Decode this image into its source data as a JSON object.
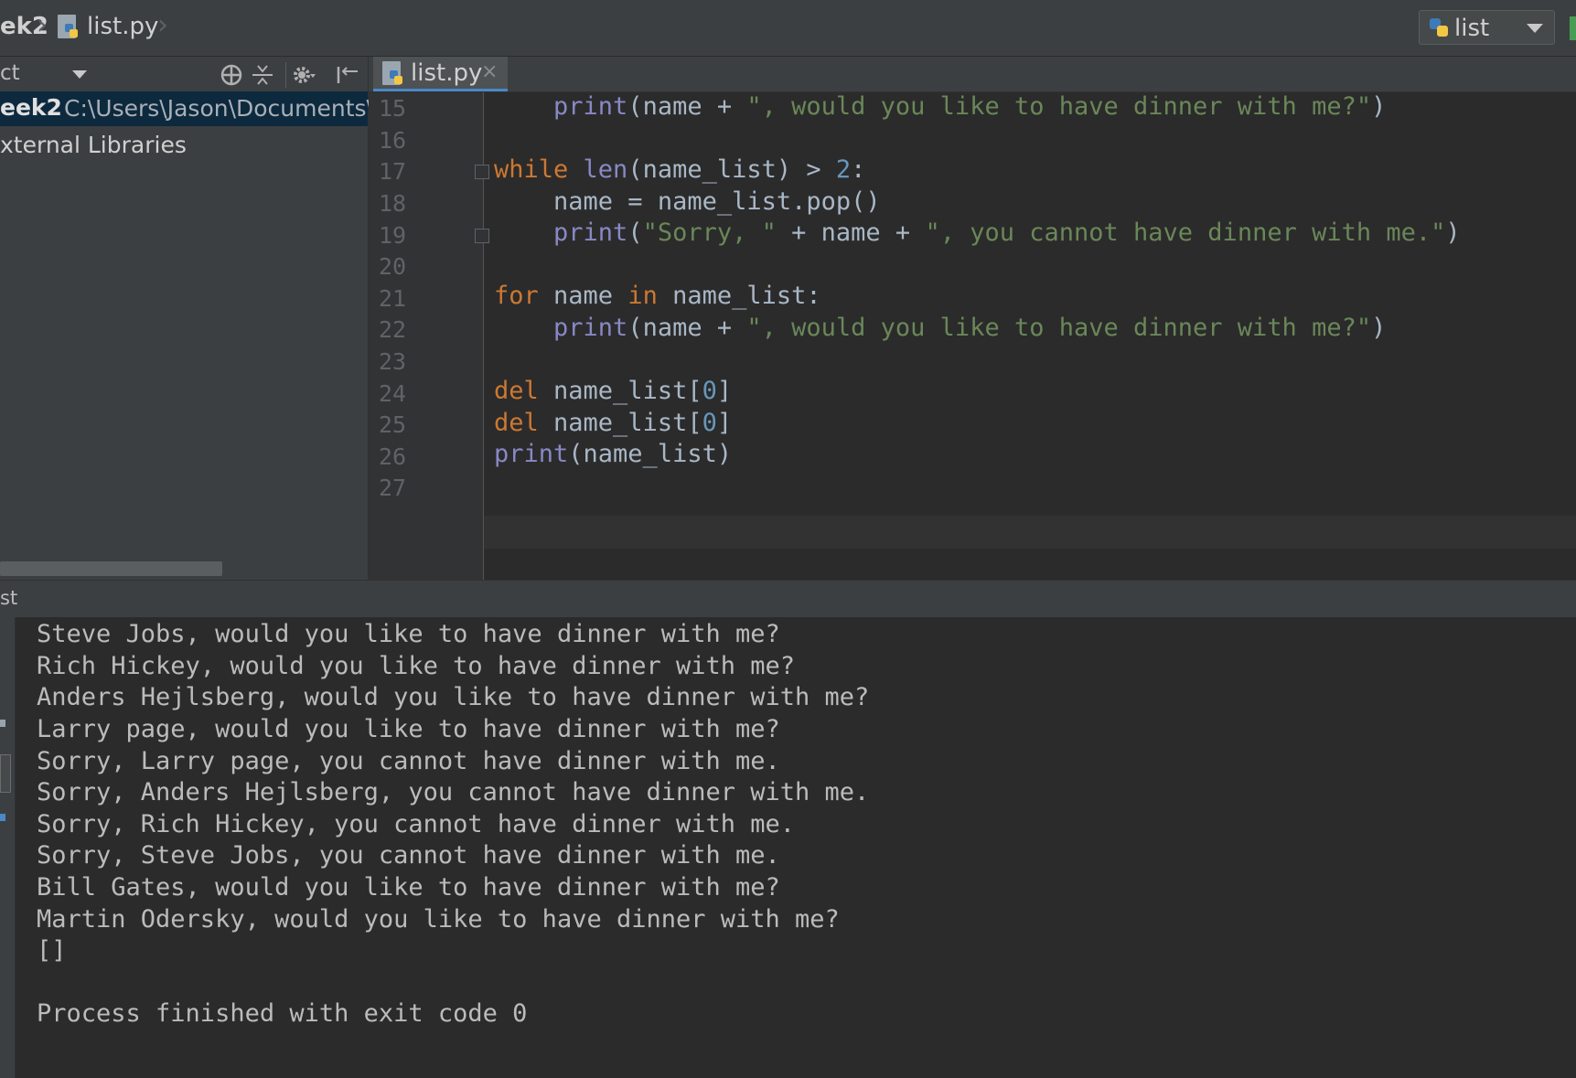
{
  "navbar": {
    "breadcrumb_project": "ek2",
    "breadcrumb_file": "list.py",
    "run_config": "list"
  },
  "project_panel": {
    "tool_label": "ct",
    "root_name": "eek2",
    "root_path": "C:\\Users\\Jason\\Documents\\C",
    "external_libraries": "xternal Libraries"
  },
  "editor": {
    "tab_label": "list.py",
    "tab_close": "×",
    "line_numbers": [
      "15",
      "16",
      "17",
      "18",
      "19",
      "20",
      "21",
      "22",
      "23",
      "24",
      "25",
      "26",
      "27"
    ],
    "code": {
      "l15": [
        "print",
        "(name + ",
        "\", would you like to have dinner with me?\"",
        ")"
      ],
      "l17": [
        "while",
        "len",
        "(name_list) > ",
        "2",
        ":"
      ],
      "l18": [
        "name = name_list.pop()"
      ],
      "l19": [
        "print",
        "(",
        "\"Sorry, \"",
        " + name + ",
        "\", you cannot have dinner with me.\"",
        ")"
      ],
      "l21": [
        "for",
        " name ",
        "in",
        " name_list:"
      ],
      "l22": [
        "print",
        "(name + ",
        "\", would you like to have dinner with me?\"",
        ")"
      ],
      "l24": [
        "del",
        " name_list[",
        "0",
        "]"
      ],
      "l25": [
        "del",
        " name_list[",
        "0",
        "]"
      ],
      "l26": [
        "print",
        "(name_list)"
      ]
    }
  },
  "run": {
    "title": "st",
    "output": [
      "Steve Jobs, would you like to have dinner with me?",
      "Rich Hickey, would you like to have dinner with me?",
      "Anders Hejlsberg, would you like to have dinner with me?",
      "Larry page, would you like to have dinner with me?",
      "Sorry, Larry page, you cannot have dinner with me.",
      "Sorry, Anders Hejlsberg, you cannot have dinner with me.",
      "Sorry, Rich Hickey, you cannot have dinner with me.",
      "Sorry, Steve Jobs, you cannot have dinner with me.",
      "Bill Gates, would you like to have dinner with me?",
      "Martin Odersky, would you like to have dinner with me?",
      "[]",
      "",
      "Process finished with exit code 0"
    ]
  },
  "icons": {
    "python_file": "python-file-icon",
    "locate": "crosshair-icon",
    "collapse": "collapse-all-icon",
    "settings": "gear-icon",
    "hide": "hide-panel-icon"
  },
  "colors": {
    "keyword": "#cc7832",
    "builtin": "#8888c6",
    "string": "#6a8759",
    "number": "#6897bb",
    "selection": "#0d293e",
    "run_green": "#499c54"
  }
}
